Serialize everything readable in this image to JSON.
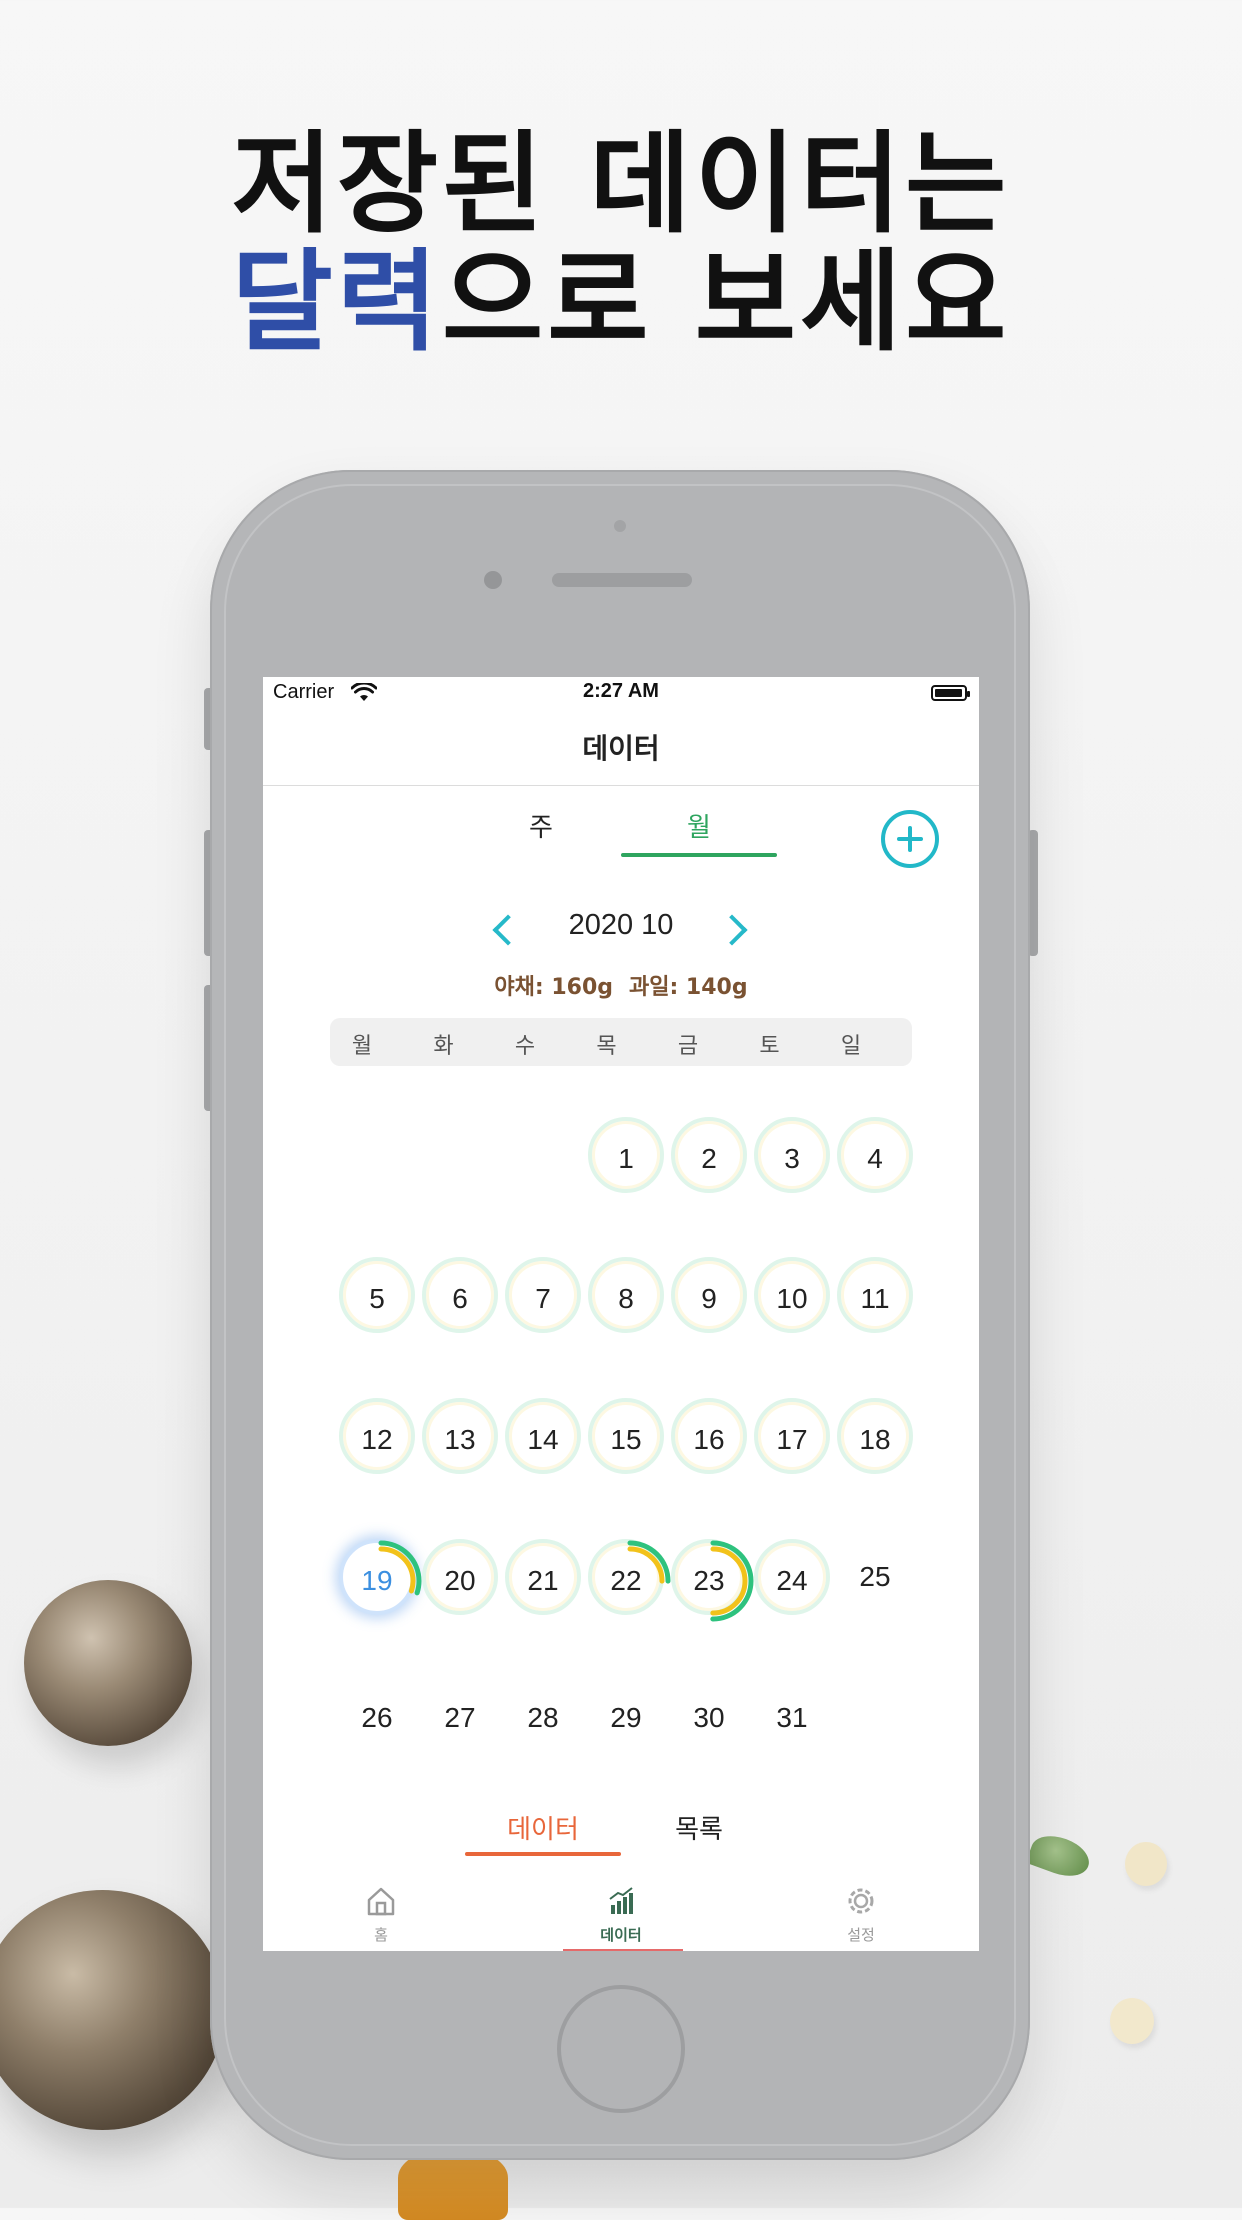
{
  "headline": {
    "line1": "저장된 데이터는",
    "accent": "달력",
    "line2_rest": "으로 보세요"
  },
  "status": {
    "carrier": "Carrier",
    "time": "2:27 AM"
  },
  "nav": {
    "title": "데이터"
  },
  "segment": {
    "week": "주",
    "month": "월",
    "selected": "월"
  },
  "calendar": {
    "month_label": "2020 10",
    "summary": {
      "vegetable": "야채: 160g",
      "fruit": "과일: 140g"
    },
    "weekdays": [
      "월",
      "화",
      "수",
      "목",
      "금",
      "토",
      "일"
    ],
    "rows": [
      [
        "",
        "",
        "",
        "1",
        "2",
        "3",
        "4"
      ],
      [
        "5",
        "6",
        "7",
        "8",
        "9",
        "10",
        "11"
      ],
      [
        "12",
        "13",
        "14",
        "15",
        "16",
        "17",
        "18"
      ],
      [
        "19",
        "20",
        "21",
        "22",
        "23",
        "24",
        "25"
      ],
      [
        "26",
        "27",
        "28",
        "29",
        "30",
        "31",
        ""
      ]
    ],
    "today": "19",
    "progress": {
      "19": 0.3,
      "22": 0.25,
      "23": 0.5
    },
    "colors": {
      "vegetable": "#2ec27e",
      "fruit": "#f2c21a",
      "today": "#3b8fe0"
    }
  },
  "bottom_tabs": {
    "data": "데이터",
    "list": "목록",
    "selected": "데이터"
  },
  "tabbar": {
    "items": [
      {
        "label": "홈",
        "icon": "home-icon"
      },
      {
        "label": "데이터",
        "icon": "chart-icon"
      },
      {
        "label": "설정",
        "icon": "gear-icon"
      }
    ],
    "selected": "데이터"
  },
  "colors": {
    "accent_blue": "#2f4ea7",
    "teal": "#22b8c8",
    "green": "#2ea55f",
    "orange": "#e8663a"
  }
}
